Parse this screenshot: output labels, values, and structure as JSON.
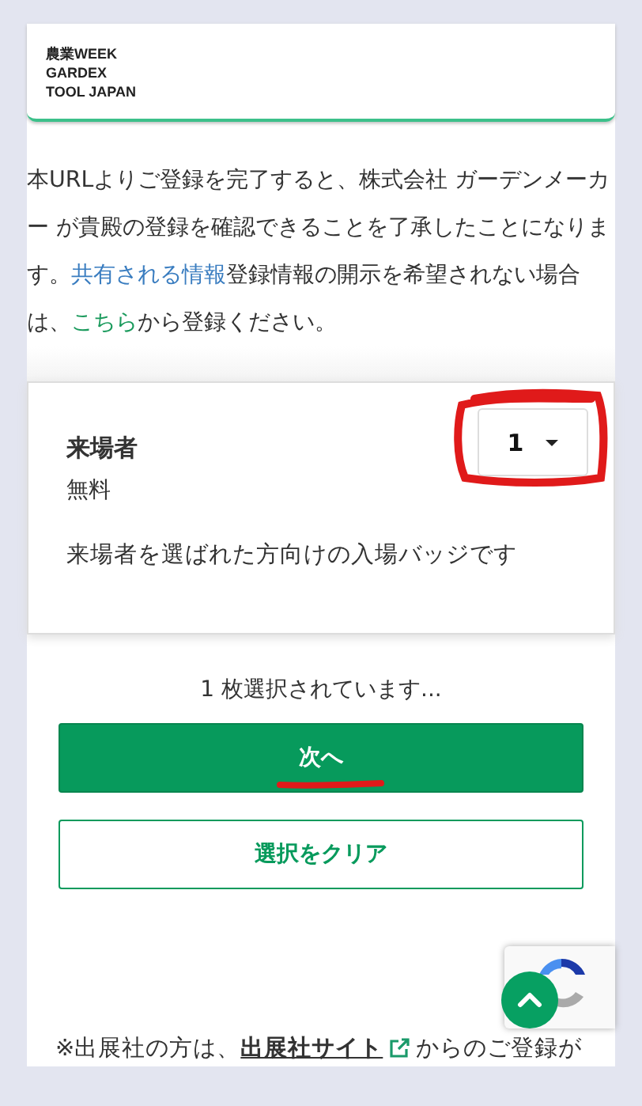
{
  "header": {
    "logo_lines": [
      "農業WEEK",
      "GARDEX",
      "TOOL JAPAN"
    ]
  },
  "notice": {
    "parts": [
      {
        "kind": "text",
        "text": "本URLよりご登録を完了すると、株式会社 ガーデンメーカー が貴殿の登録を確認できることを了承したことになります。"
      },
      {
        "kind": "link",
        "text": "共有される情報"
      },
      {
        "kind": "text",
        "text": "登録情報の開示を希望されない場合は、"
      },
      {
        "kind": "green-link",
        "text": "こちら"
      },
      {
        "kind": "text",
        "text": "から登録ください。"
      }
    ]
  },
  "ticket": {
    "name": "来場者",
    "price": "無料",
    "description": "来場者を選ばれた方向けの入場バッジです",
    "quantity": "1"
  },
  "selection_status": "1 枚選択されています...",
  "buttons": [
    {
      "kind": "primary",
      "label": "次へ"
    },
    {
      "kind": "outline",
      "label": "選択をクリア"
    }
  ],
  "footer": {
    "parts": [
      {
        "kind": "text",
        "text": "※出展社の方は、"
      },
      {
        "kind": "external-link",
        "text": "出展社サイト"
      },
      {
        "kind": "text",
        "text": " からのご登録が"
      }
    ]
  }
}
